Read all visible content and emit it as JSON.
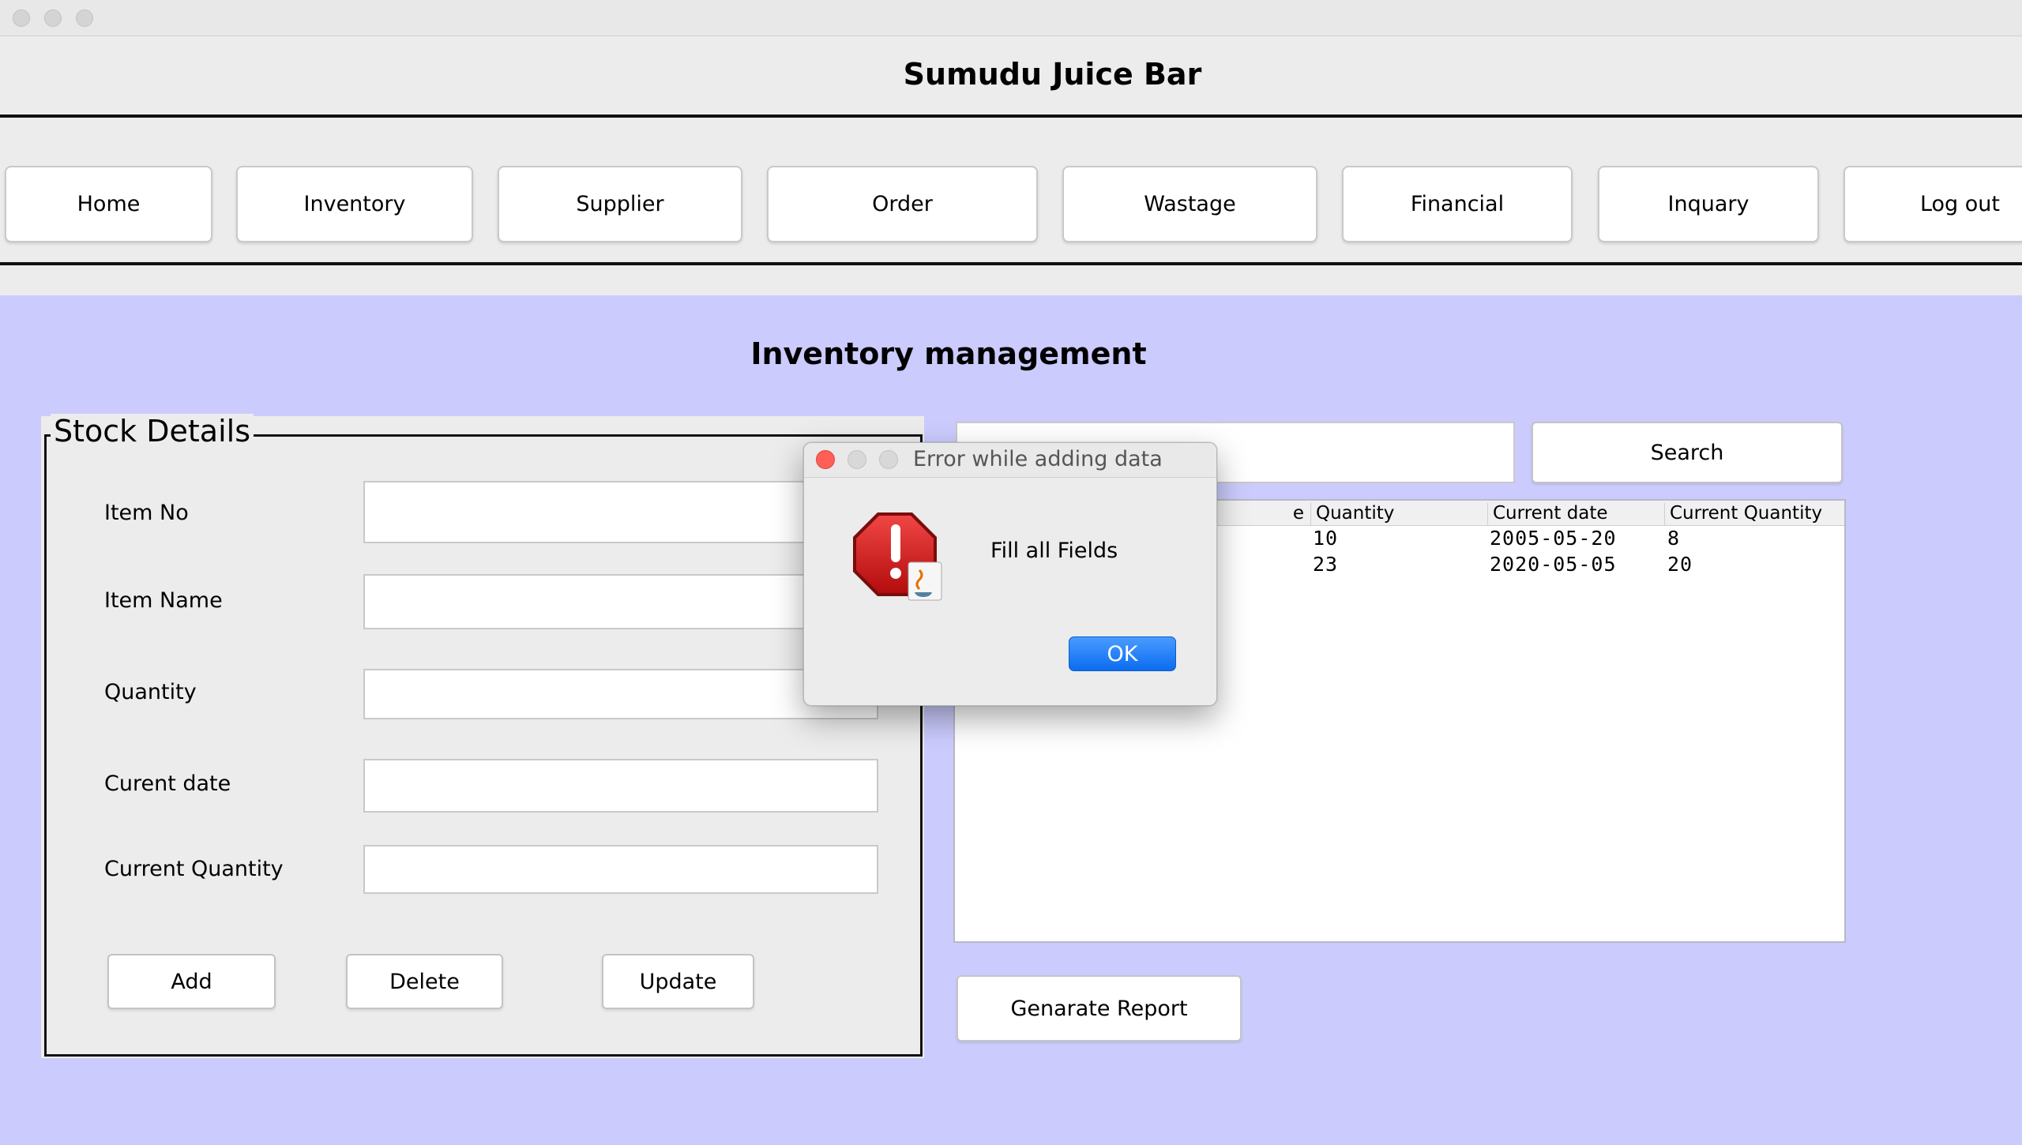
{
  "app": {
    "title": "Sumudu Juice Bar"
  },
  "nav": {
    "home": "Home",
    "inventory": "Inventory",
    "supplier": "Supplier",
    "order": "Order",
    "wastage": "Wastage",
    "financial": "Financial",
    "inquary": "Inquary",
    "logout": "Log out"
  },
  "page": {
    "title": "Inventory management"
  },
  "stock": {
    "legend": "Stock Details",
    "labels": {
      "item_no": "Item No",
      "item_name": "Item Name",
      "quantity": "Quantity",
      "curent_date": "Curent date",
      "current_quantity": "Current Quantity"
    },
    "values": {
      "item_no": "",
      "item_name": "",
      "quantity": "",
      "curent_date": "",
      "current_quantity": ""
    },
    "buttons": {
      "add": "Add",
      "delete": "Delete",
      "update": "Update"
    }
  },
  "search": {
    "value": "",
    "button": "Search"
  },
  "table": {
    "headers": {
      "partial": "e",
      "quantity": "Quantity",
      "current_date": "Current date",
      "current_quantity": "Current Quantity"
    },
    "rows": [
      {
        "quantity": "10",
        "current_date": "2005-05-20",
        "current_quantity": "8"
      },
      {
        "quantity": "23",
        "current_date": "2020-05-05",
        "current_quantity": "20"
      }
    ]
  },
  "report": {
    "button": "Genarate Report"
  },
  "dialog": {
    "title": "Error while adding data",
    "message": "Fill all Fields",
    "ok": "OK",
    "icon": "error-stop-icon",
    "close_color": "#ff5f57"
  },
  "colors": {
    "content_bg": "#cbcbfd",
    "ok_blue": "#0b6cf0"
  }
}
